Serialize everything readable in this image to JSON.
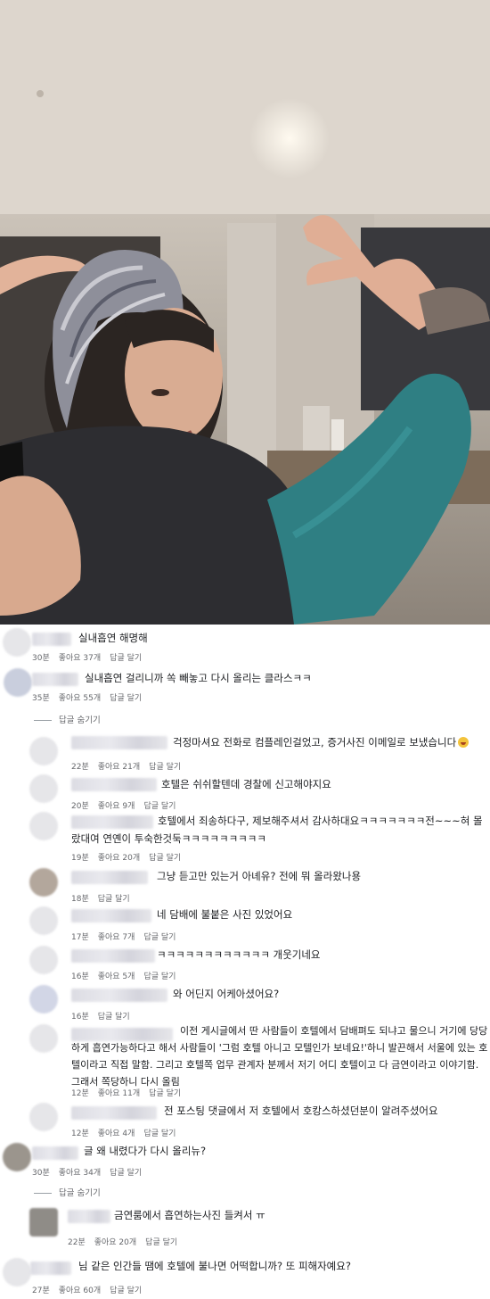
{
  "comments": [
    {
      "text": "실내흡연 해명해",
      "time": "30분",
      "likes": "좋아요 37개",
      "reply": "답글 달기"
    },
    {
      "text": "실내흡연 걸리니까 쏙 빼놓고 다시 올리는 클라스ㅋㅋ",
      "time": "35분",
      "likes": "좋아요 55개",
      "reply": "답글 달기"
    },
    {
      "text": "걱정마셔요 전화로 컴플레인걸었고, 증거사진 이메일로 보냈습니다",
      "time": "22분",
      "likes": "좋아요 21개",
      "reply": "답글 달기"
    },
    {
      "text": "호텔은 쉬쉬할텐데 경찰에 신고해야지요",
      "time": "20분",
      "likes": "좋아요 9개",
      "reply": "답글 달기"
    },
    {
      "text": "호텔에서 죄송하다구, 제보해주셔서 감사하대요ㅋㅋㅋㅋㅋㅋㅋ전~~~혀 몰랐대여 연옌이 투숙한것둑ㅋㅋㅋㅋㅋㅋㅋㅋㅋ",
      "time": "19분",
      "likes": "좋아요 20개",
      "reply": "답글 달기"
    },
    {
      "text": "그냥 듣고만 있는거 아녜유? 전에 뭐 올라왔나용",
      "time": "18분",
      "likes": "",
      "reply": "답글 달기"
    },
    {
      "text": "네 담배에 불붙은 사진 있었어요",
      "time": "17분",
      "likes": "좋아요 7개",
      "reply": "답글 달기"
    },
    {
      "text": "ㅋㅋㅋㅋㅋㅋㅋㅋㅋㅋㅋㅋ 개웃기네요",
      "time": "16분",
      "likes": "좋아요 5개",
      "reply": "답글 달기"
    },
    {
      "text": "와 어딘지 어케아셨어요?",
      "time": "16분",
      "likes": "",
      "reply": "답글 달기"
    },
    {
      "text": "이전 게시글에서 딴 사람들이 호텔에서 담배펴도 되냐고 물으니 거기에 당당하게 흡연가능하다고 해서 사람들이 '그럼 호텔 아니고 모텔인가 보네요!'하니 발끈해서 서울에 있는 호텔이라고 직접 말함. 그리고 호텔쪽 업무 관계자 분께서 저기 어디 호텔이고 다 금연이라고 이야기함. 그래서 쪽당하니 다시 올림",
      "time": "12분",
      "likes": "좋아요 11개",
      "reply": "답글 달기"
    },
    {
      "text": "전 포스팅 댓글에서 저 호텔에서 호캉스하셨던분이 알려주셨어요",
      "time": "12분",
      "likes": "좋아요 4개",
      "reply": "답글 달기"
    },
    {
      "text": "글 왜 내렸다가 다시 올리뉴?",
      "time": "30분",
      "likes": "좋아요 34개",
      "reply": "답글 달기"
    },
    {
      "text": "금연룸에서 흡연하는사진 들켜서 ㅠ",
      "time": "22분",
      "likes": "좋아요 20개",
      "reply": "답글 달기"
    },
    {
      "text": "님 같은 인간들 땜에 호텔에 불나면 어떡합니까? 또 피해자예요?",
      "time": "27분",
      "likes": "좋아요 60개",
      "reply": "답글 달기"
    }
  ],
  "hide_replies": "답글 숨기기",
  "emoji_icon": "scream-emoji-icon"
}
